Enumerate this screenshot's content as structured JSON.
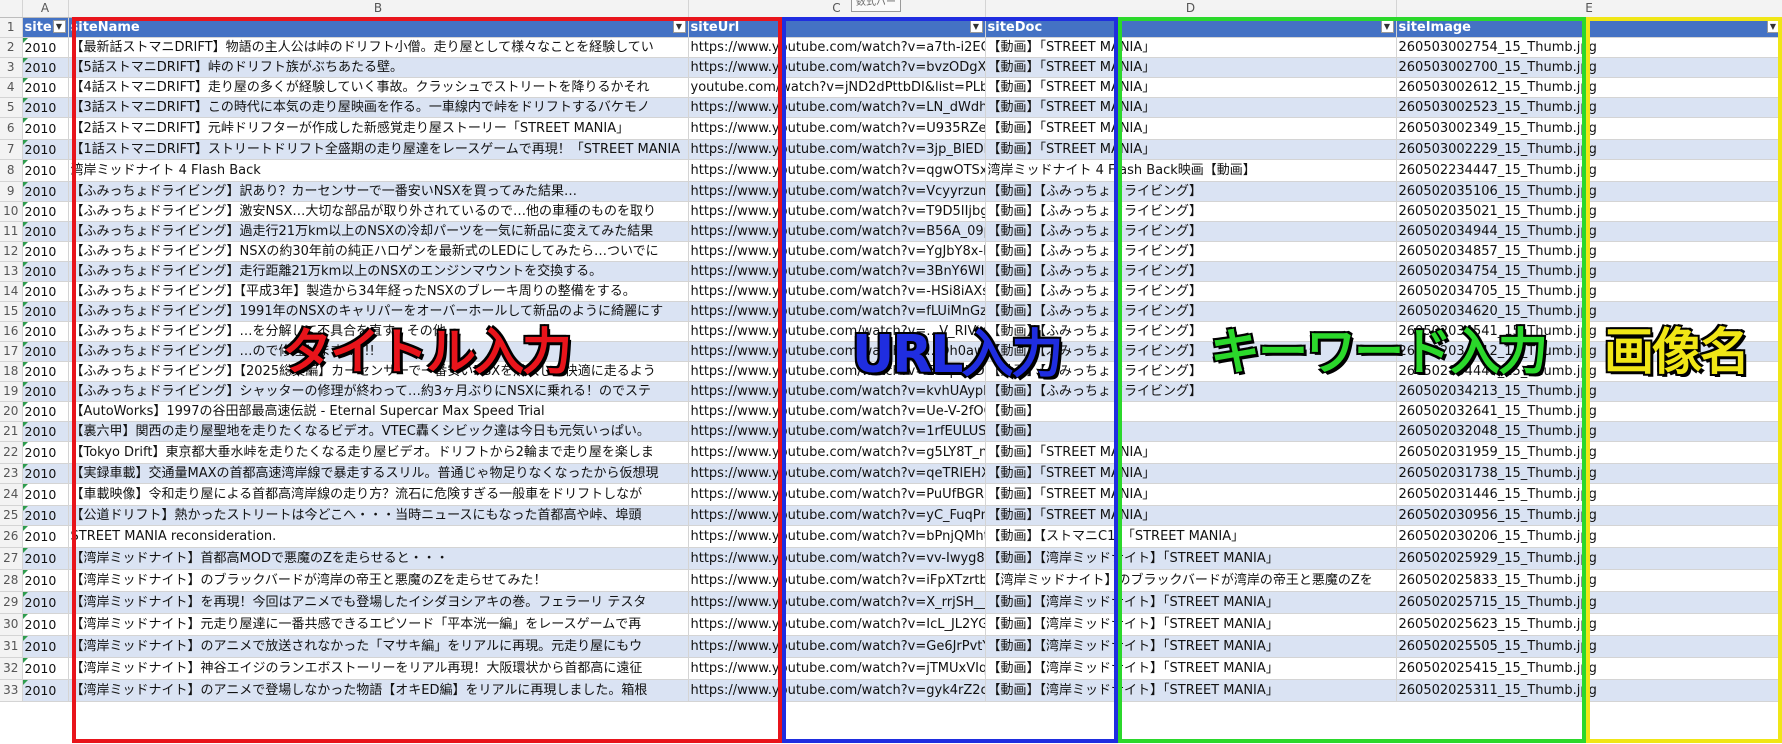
{
  "sheet": {
    "column_letters": [
      "A",
      "B",
      "C",
      "D",
      "E"
    ],
    "header": [
      "siteN",
      "siteName",
      "siteUrl",
      "siteDoc",
      "siteImage"
    ],
    "tooltip": "数式バー",
    "rows": [
      {
        "n": "2",
        "year": "2010",
        "name": "【最新話ストマニDRIFT】物語の主人公は峠のドリフト小僧。走り屋として様々なことを経験してい",
        "url": "https://www.youtube.com/watch?v=a7th-i2ECT8&list",
        "doc": "【動画】「STREET MANIA」",
        "image": "260503002754_15_Thumb.jpg"
      },
      {
        "n": "3",
        "year": "2010",
        "name": "【5話ストマニDRIFT】峠のドリフト族がぶちあたる壁。",
        "url": "https://www.youtube.com/watch?v=bvzODgXr65Q&li",
        "doc": "【動画】「STREET MANIA」",
        "image": "260503002700_15_Thumb.jpg"
      },
      {
        "n": "4",
        "year": "2010",
        "name": "【4話ストマニDRIFT】走り屋の多くが経験していく事故。クラッシュでストリートを降りるかそれ",
        "url": "youtube.com/watch?v=jND2dPttbDI&list=PLb4S7cVkJU",
        "doc": "【動画】「STREET MANIA」",
        "image": "260503002612_15_Thumb.jpg"
      },
      {
        "n": "5",
        "year": "2010",
        "name": "【3話ストマニDRIFT】この時代に本気の走り屋映画を作る。一車線内で峠をドリフトするバケモノ",
        "url": "https://www.youtube.com/watch?v=LN_dWdhZeuc&",
        "doc": "【動画】「STREET MANIA」",
        "image": "260503002523_15_Thumb.jpg"
      },
      {
        "n": "6",
        "year": "2010",
        "name": "【2話ストマニDRIFT】元峠ドリフターが作成した新感覚走り屋ストーリー「STREET MANIA」",
        "url": "https://www.youtube.com/watch?v=U935RZeXYk&list",
        "doc": "【動画】「STREET MANIA」",
        "image": "260503002349_15_Thumb.jpg"
      },
      {
        "n": "7",
        "year": "2010",
        "name": "【1話ストマニDRIFT】ストリートドリフト全盛期の走り屋達をレースゲームで再現！「STREET MANIA",
        "url": "https://www.youtube.com/watch?v=3jp_BlEDIfQ&list",
        "doc": "【動画】「STREET MANIA」",
        "image": "260503002229_15_Thumb.jpg"
      },
      {
        "n": "8",
        "year": "2010",
        "name": "湾岸ミッドナイト 4 Flash Back",
        "url": "https://www.youtube.com/watch?v=qgwOTSxVYBs",
        "doc": "湾岸ミッドナイト 4 Flash Back映画【動画】",
        "image": "260502234447_15_Thumb.jpg"
      },
      {
        "n": "9",
        "year": "2010",
        "name": "【ふみっちょドライビング】訳あり？カーセンサーで一番安いNSXを買ってみた結果…",
        "url": "https://www.youtube.com/watch?v=Vcyyrzunnuc",
        "doc": "【動画】【ふみっちょドライビング】",
        "image": "260502035106_15_Thumb.jpg"
      },
      {
        "n": "10",
        "year": "2010",
        "name": "【ふみっちょドライビング】激安NSX…大切な部品が取り外されているので…他の車種のものを取り",
        "url": "https://www.youtube.com/watch?v=T9D5IIjbgRg",
        "doc": "【動画】【ふみっちょドライビング】",
        "image": "260502035021_15_Thumb.jpg"
      },
      {
        "n": "11",
        "year": "2010",
        "name": "【ふみっちょドライビング】過走行21万km以上のNSXの冷却パーツを一気に新品に変えてみた結果",
        "url": "https://www.youtube.com/watch?v=B56A_09pqf0",
        "doc": "【動画】【ふみっちょドライビング】",
        "image": "260502034944_15_Thumb.jpg"
      },
      {
        "n": "12",
        "year": "2010",
        "name": "【ふみっちょドライビング】NSXの約30年前の純正ハロゲンを最新式のLEDにしてみたら…ついでに",
        "url": "https://www.youtube.com/watch?v=YgJbY8x-ESw",
        "doc": "【動画】【ふみっちょドライビング】",
        "image": "260502034857_15_Thumb.jpg"
      },
      {
        "n": "13",
        "year": "2010",
        "name": "【ふみっちょドライビング】走行距離21万km以上のNSXのエンジンマウントを交換する。",
        "url": "https://www.youtube.com/watch?v=3BnY6WlIoeo",
        "doc": "【動画】【ふみっちょドライビング】",
        "image": "260502034754_15_Thumb.jpg"
      },
      {
        "n": "14",
        "year": "2010",
        "name": "【ふみっちょドライビング】【平成3年】製造から34年経ったNSXのブレーキ周りの整備をする。",
        "url": "https://www.youtube.com/watch?v=-HSi8iAXsIg",
        "doc": "【動画】【ふみっちょドライビング】",
        "image": "260502034705_15_Thumb.jpg"
      },
      {
        "n": "15",
        "year": "2010",
        "name": "【ふみっちょドライビング】1991年のNSXのキャリパーをオーバーホールして新品のように綺麗にす",
        "url": "https://www.youtube.com/watch?v=fLUiMnGz-7g",
        "doc": "【動画】【ふみっちょドライビング】",
        "image": "260502034620_15_Thumb.jpg"
      },
      {
        "n": "16",
        "year": "2010",
        "name": "【ふみっちょドライビング】…を分解して不具合を直す。その他",
        "url": "https://www.youtube.com/watch?v=…V_RIVt4",
        "doc": "【動画】【ふみっちょドライビング】",
        "image": "260502034541_15_Thumb.jpg"
      },
      {
        "n": "17",
        "year": "2010",
        "name": "【ふみっちょドライビング】…ので修理します!!!!!!",
        "url": "https://www.youtube.com/watch?v=…Oh0aw-c",
        "doc": "【動画】【ふみっちょドライビング】",
        "image": "260502034512_15_Thumb.jpg"
      },
      {
        "n": "18",
        "year": "2010",
        "name": "【ふみっちょドライビング】【2025総集編】カーセンサーで一番安いNSXを購入して快適に走るよう",
        "url": "https://www.youtube.com/watch?v=Es4poVD-odU",
        "doc": "【動画】【ふみっちょドライビング】",
        "image": "260502034448_15_Thumb.jpg"
      },
      {
        "n": "19",
        "year": "2010",
        "name": "【ふみっちょドライビング】シャッターの修理が終わって…約3ヶ月ぶりにNSXに乗れる！のでステ",
        "url": "https://www.youtube.com/watch?v=kvhUAypL0h8",
        "doc": "【動画】【ふみっちょドライビング】",
        "image": "260502034213_15_Thumb.jpg"
      },
      {
        "n": "20",
        "year": "2010",
        "name": "【AutoWorks】1997の谷田部最高速伝説 - Eternal Supercar Max Speed Trial",
        "url": "https://www.youtube.com/watch?v=Ue-V-2fOCCE",
        "doc": "【動画】",
        "image": "260502032641_15_Thumb.jpg"
      },
      {
        "n": "21",
        "year": "2010",
        "name": "【裏六甲】関西の走り屋聖地を走りたくなるビデオ。VTEC轟くシビック達は今日も元気いっぱい。",
        "url": "https://www.youtube.com/watch?v=1rfEULUSq8c",
        "doc": "【動画】",
        "image": "260502032048_15_Thumb.jpg"
      },
      {
        "n": "22",
        "year": "2010",
        "name": "【Tokyo Drift】東京都大垂水峠を走りたくなる走り屋ビデオ。ドリフトから2輪まで走り屋を楽しま",
        "url": "https://www.youtube.com/watch?v=g5LY8T_nAsc",
        "doc": "【動画】「STREET MANIA」",
        "image": "260502031959_15_Thumb.jpg"
      },
      {
        "n": "23",
        "year": "2010",
        "name": "【実録車載】交通量MAXの首都高速湾岸線で暴走するスリル。普通じゃ物足りなくなったから仮想現",
        "url": "https://www.youtube.com/watch?v=qeTRlEHXB_I",
        "doc": "【動画】「STREET MANIA」",
        "image": "260502031738_15_Thumb.jpg"
      },
      {
        "n": "24",
        "year": "2010",
        "name": "【車載映像】令和走り屋による首都高湾岸線の走り方？流石に危険すぎる一般車をドリフトしなが",
        "url": "https://www.youtube.com/watch?v=PuUfBGRNCmk",
        "doc": "【動画】「STREET MANIA」",
        "image": "260502031446_15_Thumb.jpg"
      },
      {
        "n": "25",
        "year": "2010",
        "name": "【公道ドリフト】熱かったストリートは今どこへ・・・当時ニュースにもなった首都高や峠、埠頭",
        "url": "https://www.youtube.com/watch?v=yC_FuqPmq68",
        "doc": "【動画】「STREET MANIA」",
        "image": "260502030956_15_Thumb.jpg"
      },
      {
        "n": "26",
        "year": "2010",
        "name": "STREET MANIA reconsideration.",
        "url": "https://www.youtube.com/watch?v=bPnjQMht3Yo",
        "doc": "【動画】【ストマニC1】「STREET MANIA」",
        "image": "260502030206_15_Thumb.jpg"
      },
      {
        "n": "27",
        "year": "2010",
        "name": "【湾岸ミッドナイト】首都高MODで悪魔のZを走らせると・・・",
        "url": "https://www.youtube.com/watch?v=vv-Iwyg8mas",
        "doc": "【動画】【湾岸ミッドナイト】「STREET MANIA」",
        "image": "260502025929_15_Thumb.jpg"
      },
      {
        "n": "28",
        "year": "2010",
        "name": "【湾岸ミッドナイト】のブラックバードが湾岸の帝王と悪魔のZを走らせてみた！",
        "url": "https://www.youtube.com/watch?v=iFpXTzrtbCs",
        "doc": "【湾岸ミッドナイト】のブラックバードが湾岸の帝王と悪魔のZを",
        "image": "260502025833_15_Thumb.jpg"
      },
      {
        "n": "29",
        "year": "2010",
        "name": "【湾岸ミッドナイト】を再現！今回はアニメでも登場したイシダヨシアキの巻。フェラーリ テスタ",
        "url": "https://www.youtube.com/watch?v=X_rrjSH__5U",
        "doc": "【動画】【湾岸ミッドナイト】「STREET MANIA」",
        "image": "260502025715_15_Thumb.jpg"
      },
      {
        "n": "30",
        "year": "2010",
        "name": "【湾岸ミッドナイト】元走り屋達に一番共感できるエピソード「平本洸一編」をレースゲームで再",
        "url": "https://www.youtube.com/watch?v=IcL_JL2YGUw",
        "doc": "【動画】【湾岸ミッドナイト】「STREET MANIA」",
        "image": "260502025623_15_Thumb.jpg"
      },
      {
        "n": "31",
        "year": "2010",
        "name": "【湾岸ミッドナイト】のアニメで放送されなかった「マサキ編」をリアルに再現。元走り屋にもウ",
        "url": "https://www.youtube.com/watch?v=Ge6JrPvtYro",
        "doc": "【動画】【湾岸ミッドナイト】「STREET MANIA」",
        "image": "260502025505_15_Thumb.jpg"
      },
      {
        "n": "32",
        "year": "2010",
        "name": "【湾岸ミッドナイト】神谷エイジのランエボストーリーをリアル再現！大阪環状から首都高に遠征",
        "url": "https://www.youtube.com/watch?v=jTMUxVIqDY8",
        "doc": "【動画】【湾岸ミッドナイト】「STREET MANIA」",
        "image": "260502025415_15_Thumb.jpg"
      },
      {
        "n": "33",
        "year": "2010",
        "name": "【湾岸ミッドナイト】のアニメで登場しなかった物語【オキED編】をリアルに再現しました。箱根",
        "url": "https://www.youtube.com/watch?v=gyk4rZ2cfLg",
        "doc": "【動画】【湾岸ミッドナイト】「STREET MANIA」",
        "image": "260502025311_15_Thumb.jpg"
      }
    ]
  },
  "overlays": {
    "title_label": "タイトル入力",
    "url_label": "URL入力",
    "keyword_label": "キーワード入力",
    "image_label": "画像名",
    "colors": {
      "title": "#e8141b",
      "url": "#1f2de0",
      "keyword": "#2bd82b",
      "image": "#f0e616"
    }
  }
}
